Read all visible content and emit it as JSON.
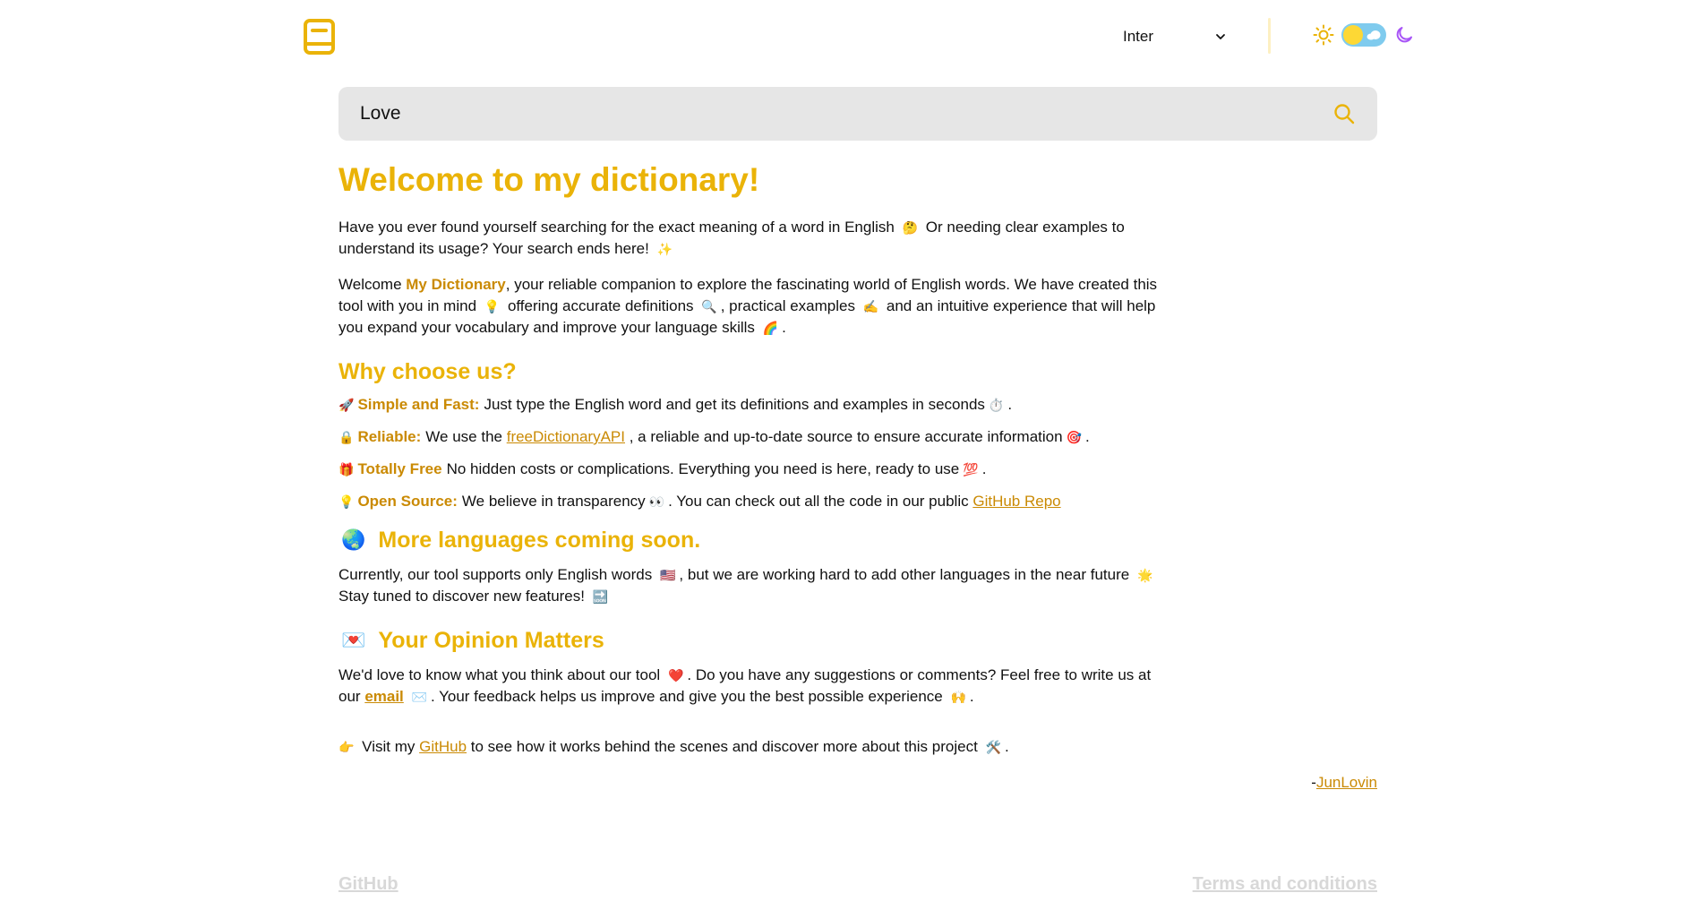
{
  "header": {
    "logo_icon": "book-icon",
    "font_select": {
      "value": "Inter",
      "icon": "chevron-down-icon"
    },
    "theme": {
      "sun_icon": "sun-icon",
      "moon_icon": "moon-icon"
    }
  },
  "search": {
    "value": "Love",
    "icon": "search-icon"
  },
  "main": {
    "title": "Welcome to my dictionary!",
    "intro": {
      "text_a": "Have you ever found yourself searching for the exact meaning of a word in English",
      "emoji_a": "🤔",
      "text_b": "Or needing clear examples to understand its usage? Your search ends here!",
      "emoji_b": "✨"
    },
    "welcome": {
      "t1": "Welcome ",
      "brand": "My Dictionary",
      "t2": ", your reliable companion to explore the fascinating world of English words. We have created this tool with you in mind",
      "e1": "💡",
      "t3": "offering accurate definitions",
      "e2": "🔍",
      "t4": ", practical examples",
      "e3": "✍️",
      "t5": "and an intuitive experience that will help you expand your vocabulary and improve your language skills",
      "e4": "🌈",
      "t6": "."
    },
    "why_title": "Why choose us?",
    "reasons": [
      {
        "emoji": "🚀",
        "label": "Simple and Fast:",
        "text": "Just type the English word and get its definitions and examples in seconds",
        "end_emoji": "⏱️",
        "end": "."
      },
      {
        "emoji": "🔒",
        "label": "Reliable:",
        "text_a": "We use the",
        "link": "freeDictionaryAPI",
        "text_b": ", a reliable and up-to-date source to ensure accurate information",
        "end_emoji": "🎯",
        "end": "."
      },
      {
        "emoji": "🎁",
        "label": "Totally Free",
        "text": "No hidden costs or complications. Everything you need is here, ready to use",
        "end_emoji": "💯",
        "end": "."
      },
      {
        "emoji": "💡",
        "label": "Open Source:",
        "text_a": "We believe in transparency",
        "mid_emoji": "👀",
        "text_b": ". You can check out all the code in our public",
        "link": "GitHub Repo"
      }
    ],
    "languages": {
      "emoji": "🌏",
      "title": "More languages coming soon.",
      "text_a": "Currently, our tool supports only English words",
      "e1": "🇺🇸",
      "text_b": ", but we are working hard to add other languages in the near future",
      "e2": "🌟",
      "text_c": "Stay tuned to discover new features!",
      "e3": "🔜"
    },
    "opinion": {
      "emoji": "💌",
      "title": "Your Opinion Matters",
      "text_a": "We'd love to know what you think about our tool",
      "e1": "❤️",
      "text_b": ". Do you have any suggestions or comments? Feel free to write us at our",
      "link": "email",
      "e2": "✉️",
      "text_c": ". Your feedback helps us improve and give you the best possible experience",
      "e3": "🙌",
      "end": "."
    },
    "visit": {
      "emoji": "👉",
      "text_a": "Visit my",
      "link": "GitHub",
      "text_b": "to see how it works behind the scenes and discover more about this project",
      "e1": "🛠️",
      "end": "."
    },
    "signature": {
      "prefix": "-",
      "link": "JunLovin"
    }
  },
  "footer": {
    "github": "GitHub",
    "terms": "Terms and conditions"
  },
  "colors": {
    "accent": "#eab308",
    "accent_dark": "#ca8a04",
    "search_bg": "#e6e6e6",
    "footer_link": "#d8d8d8"
  }
}
